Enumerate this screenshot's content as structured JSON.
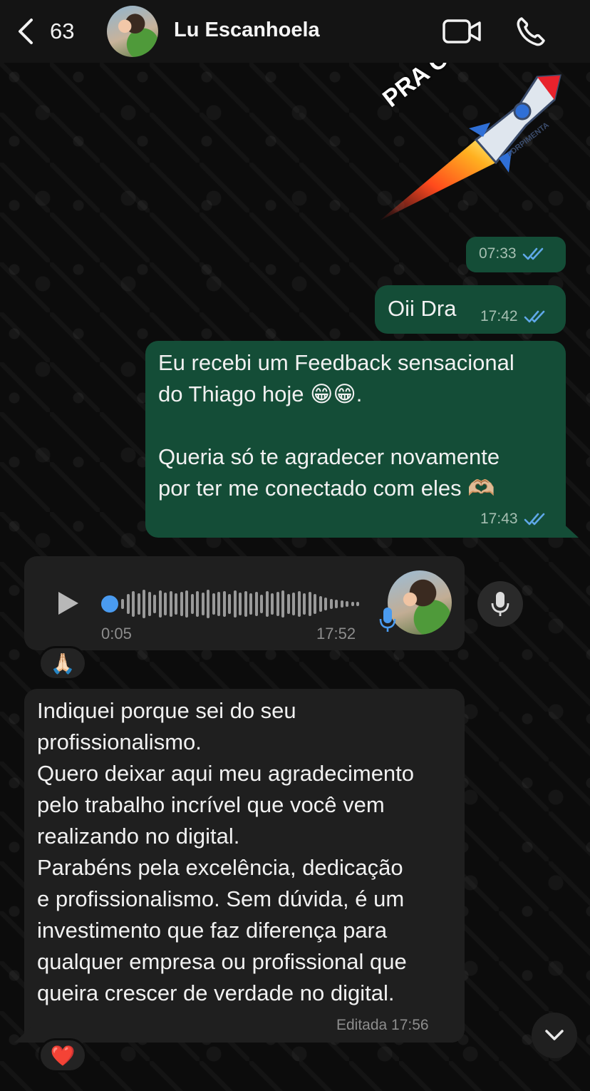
{
  "header": {
    "back_count": "63",
    "contact_name": "Lu Escanhoela",
    "icons": [
      "chevron-left-icon",
      "video-camera-icon",
      "phone-icon"
    ]
  },
  "sticker": {
    "text": "PRA CIMAAA!!!",
    "tag": "#DRPIMENTA",
    "time": "07:33"
  },
  "messages": [
    {
      "text": "Oii Dra",
      "time": "17:42"
    },
    {
      "text": "Eu recebi um Feedback sensacional\ndo Thiago hoje 😁😁.\n\nQueria só te agradecer novamente\npor ter me conectado com eles 🫶🏼",
      "time": "17:43"
    }
  ],
  "voice_note": {
    "duration": "0:05",
    "time": "17:52",
    "reaction": "🙏🏻",
    "progress": 0.0
  },
  "incoming_text": {
    "text": "Indiquei porque sei do seu\nprofissionalismo.\nQuero deixar aqui meu agradecimento\npelo trabalho incrível que você vem\nrealizando no digital.\nParabéns pela excelência, dedicação\ne profissionalismo. Sem dúvida, é um\ninvestimento que faz diferença para\nqualquer empresa ou profissional que\nqueira crescer de verdade no digital.",
    "edited_time": "Editada 17:56",
    "reaction": "❤️"
  },
  "colors": {
    "outgoing_bubble": "#144d37",
    "incoming_bubble": "#1f1f1f",
    "read_ticks": "#5fa8e8"
  }
}
